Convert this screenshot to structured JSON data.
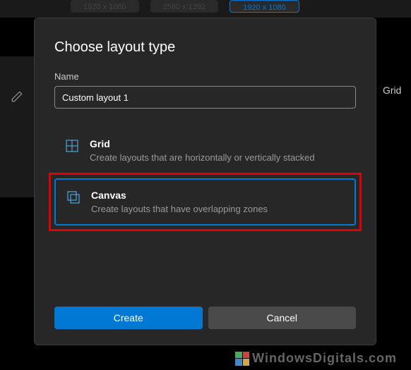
{
  "bg": {
    "res1": "1920 x 1080",
    "res2": "2560 x 1392",
    "res3": "1920 x 1080",
    "rightText": "Grid"
  },
  "dialog": {
    "title": "Choose layout type",
    "nameLabel": "Name",
    "nameValue": "Custom layout 1",
    "options": [
      {
        "title": "Grid",
        "desc": "Create layouts that are horizontally or vertically stacked"
      },
      {
        "title": "Canvas",
        "desc": "Create layouts that have overlapping zones"
      }
    ],
    "createLabel": "Create",
    "cancelLabel": "Cancel"
  },
  "watermark": "WindowsDigitals.com"
}
